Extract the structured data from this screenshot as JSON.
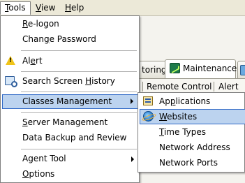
{
  "menubar": {
    "items": [
      "Tools",
      "View",
      "Help"
    ],
    "mnemonic_letters": [
      "T",
      "V",
      "H"
    ],
    "active": "Tools"
  },
  "tabs": [
    {
      "label": "toring",
      "selected": false
    },
    {
      "label": "Maintenance",
      "selected": true,
      "icon": "maintenance-icon"
    }
  ],
  "subbar": {
    "items": [
      "Remote Control",
      "Alert"
    ]
  },
  "tools_menu": {
    "items": [
      {
        "pre": "",
        "key": "R",
        "post": "e-logon",
        "icon": null
      },
      {
        "pre": "Chan",
        "key": "g",
        "post": "e Password",
        "icon": null
      },
      {
        "pre": "Al",
        "key": "e",
        "post": "rt",
        "icon": "alert-icon"
      },
      {
        "pre": "Search Screen ",
        "key": "H",
        "post": "istory",
        "icon": "search-history-icon"
      },
      {
        "pre": "Classes Management",
        "key": "",
        "post": "",
        "submenu": true,
        "highlighted": true
      },
      {
        "pre": "",
        "key": "S",
        "post": "erver Management",
        "icon": null
      },
      {
        "pre": "Data Backup and Review",
        "key": "",
        "post": "",
        "icon": null
      },
      {
        "pre": "Agent Tool",
        "key": "",
        "post": "",
        "submenu": true
      },
      {
        "pre": "",
        "key": "O",
        "post": "ptions",
        "icon": null
      }
    ]
  },
  "classes_submenu": {
    "items": [
      {
        "pre": "Ap",
        "key": "p",
        "post": "lications",
        "icon": "applications-icon"
      },
      {
        "pre": "",
        "key": "W",
        "post": "ebsites",
        "icon": "websites-icon",
        "highlighted": true
      },
      {
        "pre": "",
        "key": "T",
        "post": "ime Types"
      },
      {
        "pre": "Network Address",
        "key": "",
        "post": ""
      },
      {
        "pre": "Network Ports",
        "key": "",
        "post": ""
      }
    ]
  },
  "colors": {
    "highlight_bg": "#bcd3ef",
    "highlight_border": "#3169c6",
    "menu_bg": "#ffffff",
    "chrome_bg": "#ece9d8"
  }
}
